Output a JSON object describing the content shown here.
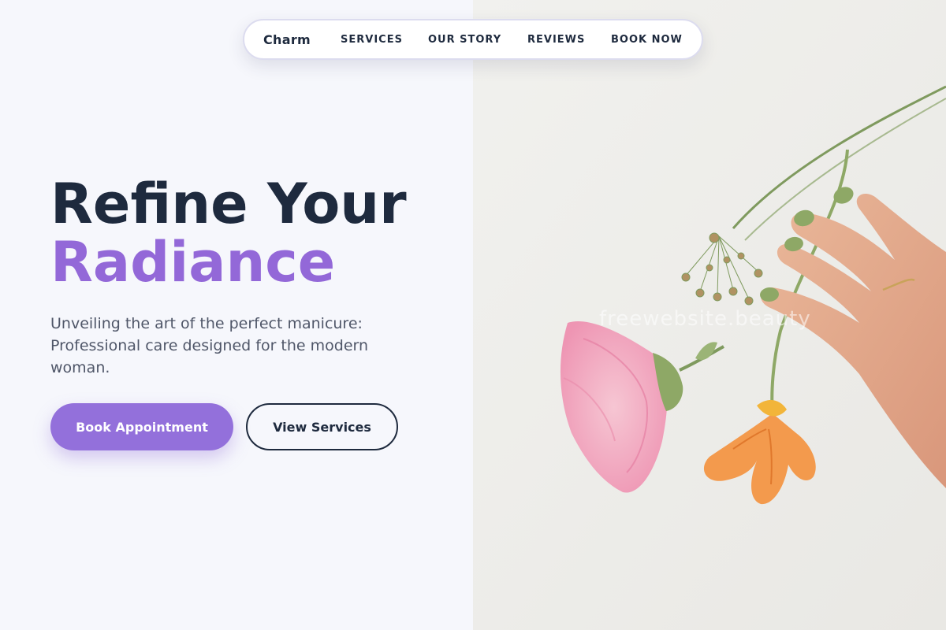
{
  "nav": {
    "brand": "Charm",
    "links": [
      "SERVICES",
      "OUR STORY",
      "REVIEWS",
      "BOOK NOW"
    ]
  },
  "hero": {
    "title_line1": "Refine Your",
    "title_line2": "Radiance",
    "subtitle": "Unveiling the art of the perfect manicure: Professional care designed for the modern woman.",
    "primary_button": "Book Appointment",
    "secondary_button": "View Services"
  },
  "image": {
    "watermark": "freewebsite.beauty",
    "subject": "hand-with-flowers-photo"
  },
  "colors": {
    "accent": "#9370db",
    "dark": "#1e2a3e",
    "background": "#f6f7fc"
  }
}
